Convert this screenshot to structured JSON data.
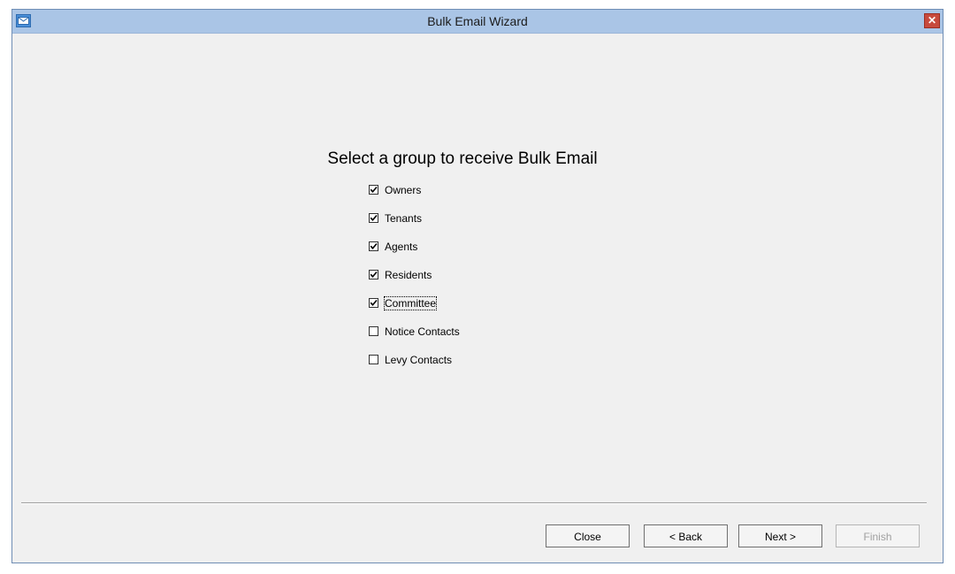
{
  "window": {
    "title": "Bulk Email Wizard",
    "close_glyph": "✕",
    "app_icon": "envelope-icon"
  },
  "main": {
    "heading": "Select a group to receive Bulk Email",
    "groups": [
      {
        "label": "Owners",
        "checked": true
      },
      {
        "label": "Tenants",
        "checked": true
      },
      {
        "label": "Agents",
        "checked": true
      },
      {
        "label": "Residents",
        "checked": true
      },
      {
        "label": "Committee",
        "checked": true,
        "focused": true
      },
      {
        "label": "Notice Contacts",
        "checked": false
      },
      {
        "label": "Levy Contacts",
        "checked": false
      }
    ]
  },
  "footer": {
    "close_label": "Close",
    "back_label": "< Back",
    "next_label": "Next >",
    "finish_label": "Finish",
    "finish_enabled": false
  },
  "colors": {
    "titlebar": "#aac5e6",
    "close_button": "#c74a3d",
    "client_bg": "#f0f0f0"
  }
}
